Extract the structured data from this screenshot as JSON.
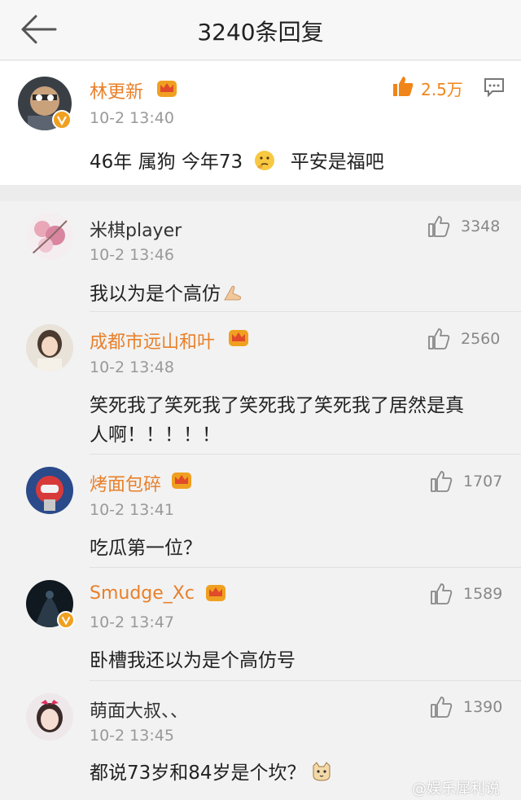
{
  "header": {
    "title": "3240条回复"
  },
  "main_comment": {
    "user": "林更新",
    "time": "10-2 13:40",
    "likes": "2.5万",
    "text": "46年 属狗 今年73",
    "text_after_emoji": "平安是福吧",
    "emoji": "thinking-face"
  },
  "replies": [
    {
      "user": "米棋player",
      "time": "10-2 13:46",
      "likes": "3348",
      "text": "我以为是个高仿",
      "emoji": "pray-hands",
      "vip": false
    },
    {
      "user": "成都市远山和叶",
      "time": "10-2 13:48",
      "likes": "2560",
      "text_line1": "笑死我了笑死我了笑死我了笑死我了居然是真",
      "text_line2": "人啊！！！！！",
      "vip": true,
      "vip_level": "6"
    },
    {
      "user": "烤面包碎",
      "time": "10-2 13:41",
      "likes": "1707",
      "text": "吃瓜第一位？",
      "vip": true,
      "vip_level": "4"
    },
    {
      "user": "Smudge_Xc",
      "time": "10-2 13:47",
      "likes": "1589",
      "text": "卧槽我还以为是个高仿号",
      "vip": true,
      "vip_level": "6"
    },
    {
      "user": "萌面大叔、、",
      "time": "10-2 13:45",
      "likes": "1390",
      "text": "都说73岁和84岁是个坎？",
      "emoji": "cat-face",
      "vip": false
    }
  ],
  "watermark": "@娱乐犀利说",
  "colors": {
    "vip_name": "#e8802a",
    "like_hot": "#f0851a",
    "verified_badge": "#f0a020",
    "background": "#f2f2f2"
  }
}
